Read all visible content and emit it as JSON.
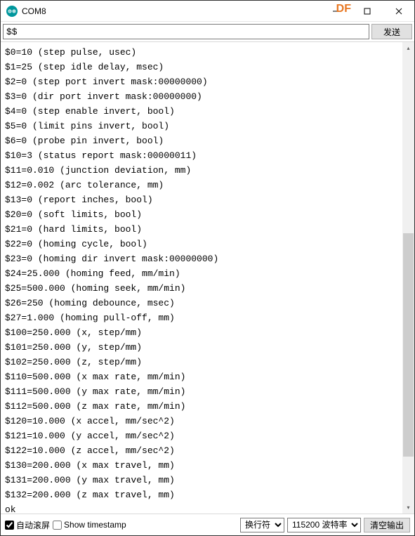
{
  "window": {
    "title": "COM8",
    "watermark": "DF"
  },
  "input": {
    "value": "$$",
    "send_label": "发送"
  },
  "console_lines": [
    "$0=10 (step pulse, usec)",
    "$1=25 (step idle delay, msec)",
    "$2=0 (step port invert mask:00000000)",
    "$3=0 (dir port invert mask:00000000)",
    "$4=0 (step enable invert, bool)",
    "$5=0 (limit pins invert, bool)",
    "$6=0 (probe pin invert, bool)",
    "$10=3 (status report mask:00000011)",
    "$11=0.010 (junction deviation, mm)",
    "$12=0.002 (arc tolerance, mm)",
    "$13=0 (report inches, bool)",
    "$20=0 (soft limits, bool)",
    "$21=0 (hard limits, bool)",
    "$22=0 (homing cycle, bool)",
    "$23=0 (homing dir invert mask:00000000)",
    "$24=25.000 (homing feed, mm/min)",
    "$25=500.000 (homing seek, mm/min)",
    "$26=250 (homing debounce, msec)",
    "$27=1.000 (homing pull-off, mm)",
    "$100=250.000 (x, step/mm)",
    "$101=250.000 (y, step/mm)",
    "$102=250.000 (z, step/mm)",
    "$110=500.000 (x max rate, mm/min)",
    "$111=500.000 (y max rate, mm/min)",
    "$112=500.000 (z max rate, mm/min)",
    "$120=10.000 (x accel, mm/sec^2)",
    "$121=10.000 (y accel, mm/sec^2)",
    "$122=10.000 (z accel, mm/sec^2)",
    "$130=200.000 (x max travel, mm)",
    "$131=200.000 (y max travel, mm)",
    "$132=200.000 (z max travel, mm)",
    "ok",
    ""
  ],
  "bottom": {
    "autoscroll_label": "自动滚屏",
    "timestamp_label": "Show timestamp",
    "line_ending_selected": "换行符",
    "baud_selected": "115200 波特率",
    "clear_label": "清空输出"
  }
}
